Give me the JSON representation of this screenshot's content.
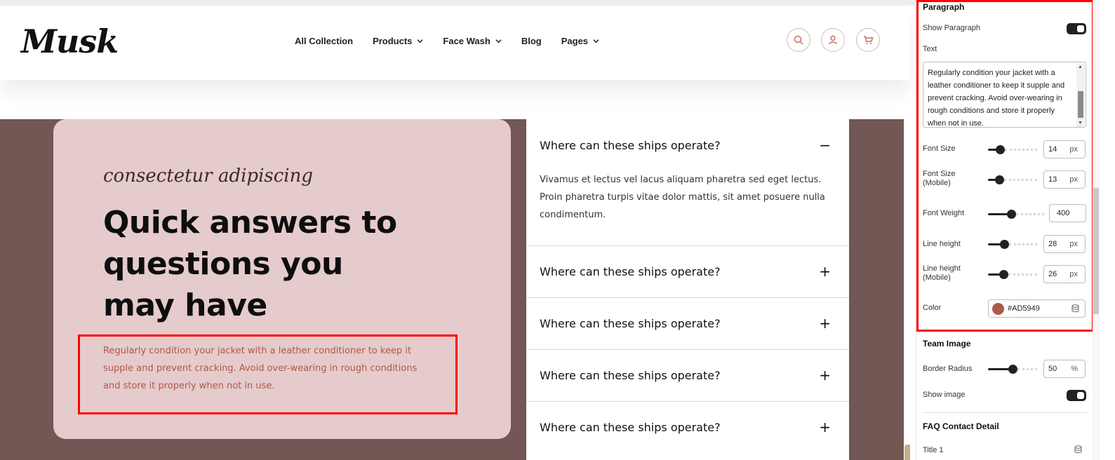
{
  "header": {
    "logo": "Musk",
    "nav": [
      {
        "label": "All Collection",
        "has_dropdown": false
      },
      {
        "label": "Products",
        "has_dropdown": true
      },
      {
        "label": "Face Wash",
        "has_dropdown": true
      },
      {
        "label": "Blog",
        "has_dropdown": false
      },
      {
        "label": "Pages",
        "has_dropdown": true
      }
    ],
    "icons": [
      "search-icon",
      "user-icon",
      "cart-icon"
    ],
    "accent": "#c7695b"
  },
  "faq_section": {
    "subtitle": "consectetur adipiscing",
    "title_lines": [
      "Quick answers to",
      "questions you",
      "may have"
    ],
    "paragraph": "Regularly condition your jacket with a leather conditioner to keep it supple and prevent cracking. Avoid over-wearing in rough conditions and store it properly when not in use.",
    "items": [
      {
        "question": "Where can these ships operate?",
        "toggle": "−",
        "expanded": true,
        "answer": "Vivamus et lectus vel lacus aliquam pharetra sed eget lectus. Proin pharetra turpis vitae dolor mattis, sit amet posuere nulla condimentum."
      },
      {
        "question": "Where can these ships operate?",
        "toggle": "+",
        "expanded": false
      },
      {
        "question": "Where can these ships operate?",
        "toggle": "+",
        "expanded": false
      },
      {
        "question": "Where can these ships operate?",
        "toggle": "+",
        "expanded": false
      },
      {
        "question": "Where can these ships operate?",
        "toggle": "+",
        "expanded": false
      }
    ],
    "colors": {
      "hero_bg": "#735755",
      "card_bg": "#e5cbcc",
      "paragraph": "#AD5949"
    }
  },
  "settings": {
    "paragraph_heading": "Paragraph",
    "show_paragraph_label": "Show Paragraph",
    "show_paragraph": true,
    "text_label": "Text",
    "text_value": "Regularly condition your jacket with a leather conditioner to keep it supple and prevent cracking. Avoid over-wearing in rough conditions and store it properly when not in use.",
    "font_size": {
      "label": "Font Size",
      "value": "14",
      "unit": "px",
      "level": 0.2
    },
    "font_size_mobile": {
      "label_1": "Font Size",
      "label_2": "(Mobile)",
      "value": "13",
      "unit": "px",
      "level": 0.18
    },
    "font_weight": {
      "label": "Font Weight",
      "value": "400",
      "level": 0.4
    },
    "line_height": {
      "label": "Line height",
      "value": "28",
      "unit": "px",
      "level": 0.3
    },
    "line_height_mobile": {
      "label_1": "Line height",
      "label_2": "(Mobile)",
      "value": "26",
      "unit": "px",
      "level": 0.28
    },
    "color": {
      "label": "Color",
      "value": "#AD5949"
    },
    "team_image_heading": "Team Image",
    "border_radius": {
      "label": "Border Radius",
      "value": "50",
      "unit": "%",
      "level": 0.5
    },
    "show_image_label": "Show image",
    "show_image": true,
    "faq_contact_heading": "FAQ Contact Detail",
    "title1_label": "Title 1"
  }
}
